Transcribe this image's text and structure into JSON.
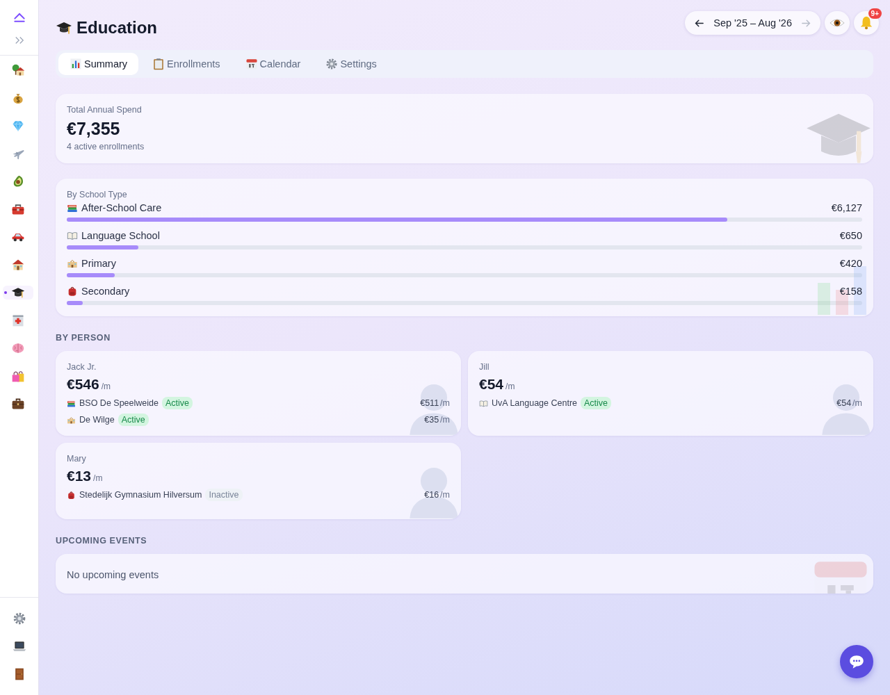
{
  "sidebar": {
    "items": [
      {
        "selected": false
      },
      {
        "selected": false
      },
      {
        "selected": false
      },
      {
        "selected": false
      },
      {
        "selected": false
      },
      {
        "selected": false
      },
      {
        "selected": false
      },
      {
        "selected": false
      },
      {
        "selected": true
      },
      {
        "selected": false
      },
      {
        "selected": false
      },
      {
        "selected": false
      },
      {
        "selected": false
      }
    ]
  },
  "header": {
    "title": "Education",
    "period": "Sep '25 – Aug '26",
    "notification_badge": "9+"
  },
  "tabs": [
    {
      "label": "Summary",
      "selected": true
    },
    {
      "label": "Enrollments",
      "selected": false
    },
    {
      "label": "Calendar",
      "selected": false
    },
    {
      "label": "Settings",
      "selected": false
    }
  ],
  "total": {
    "label": "Total Annual Spend",
    "amount": "€7,355",
    "subtitle": "4 active enrollments"
  },
  "school_types": {
    "title": "By School Type",
    "items": [
      {
        "kind": "after_school",
        "label": "After-School Care",
        "amount": "€6,127",
        "level": 0.83
      },
      {
        "kind": "language",
        "label": "Language School",
        "amount": "€650",
        "level": 0.09
      },
      {
        "kind": "primary",
        "label": "Primary",
        "amount": "€420",
        "level": 0.06
      },
      {
        "kind": "secondary",
        "label": "Secondary",
        "amount": "€158",
        "level": 0.02
      }
    ]
  },
  "by_person": {
    "title": "BY PERSON",
    "people": [
      {
        "name": "Jack Jr.",
        "amount": "€546",
        "unit": "/m",
        "enrollments": [
          {
            "kind": "after_school",
            "name": "BSO De Speelweide",
            "status": "Active",
            "active": true,
            "amount": "€511",
            "unit": "/m"
          },
          {
            "kind": "primary",
            "name": "De Wilge",
            "status": "Active",
            "active": true,
            "amount": "€35",
            "unit": "/m"
          }
        ]
      },
      {
        "name": "Jill",
        "amount": "€54",
        "unit": "/m",
        "enrollments": [
          {
            "kind": "language",
            "name": "UvA Language Centre",
            "status": "Active",
            "active": true,
            "amount": "€54",
            "unit": "/m"
          }
        ]
      },
      {
        "name": "Mary",
        "amount": "€13",
        "unit": "/m",
        "enrollments": [
          {
            "kind": "secondary",
            "name": "Stedelijk Gymnasium Hilversum",
            "status": "Inactive",
            "active": false,
            "amount": "€16",
            "unit": "/m"
          }
        ]
      }
    ]
  },
  "upcoming": {
    "title": "UPCOMING EVENTS",
    "empty_text": "No upcoming events"
  }
}
